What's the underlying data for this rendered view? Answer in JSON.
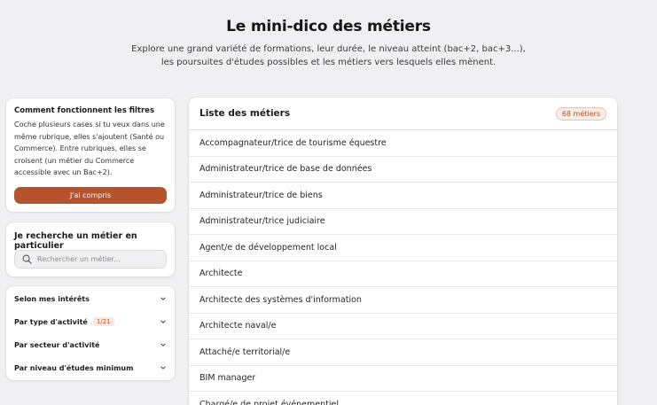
{
  "hero": {
    "title": "Le mini-dico des métiers",
    "subtitle_line1": "Explore une grand variété de formations, leur durée, le niveau atteint (bac+2, bac+3...),",
    "subtitle_line2": "les poursuites d'études possibles et les métiers vers lesquels elles mènent."
  },
  "help": {
    "heading": "Comment fonctionnent les filtres",
    "text": "Coche plusieurs cases si tu veux dans une même rubrique, elles s'ajoutent (Santé ou Commerce). Entre rubriques, elles se croisent (un métier du Commerce accessible avec un Bac+2).",
    "button_label": "J'ai compris"
  },
  "search": {
    "heading": "Je recherche un métier en particulier",
    "placeholder": "Rechercher un métier...",
    "value": ""
  },
  "filters": [
    {
      "label": "Selon mes intérêts",
      "badge": ""
    },
    {
      "label": "Par type d'activité",
      "badge": "1/21"
    },
    {
      "label": "Par secteur d'activité",
      "badge": ""
    },
    {
      "label": "Par niveau d'études minimum",
      "badge": ""
    }
  ],
  "list": {
    "title": "Liste des métiers",
    "count": "68 métiers",
    "items": [
      "Accompagnateur/trice de tourisme équestre",
      "Administrateur/trice de base de données",
      "Administrateur/trice de biens",
      "Administrateur/trice judiciaire",
      "Agent/e de développement local",
      "Architecte",
      "Architecte des systèmes d'information",
      "Architecte naval/e",
      "Attaché/e territorial/e",
      "BIM manager",
      "Chargé/e de projet événementiel"
    ]
  },
  "colors": {
    "accent": "#b5532c",
    "background": "#f0f0f2",
    "card": "#ffffff"
  },
  "icons": {
    "search": "search-icon",
    "chevron": "chevron-down-icon"
  }
}
